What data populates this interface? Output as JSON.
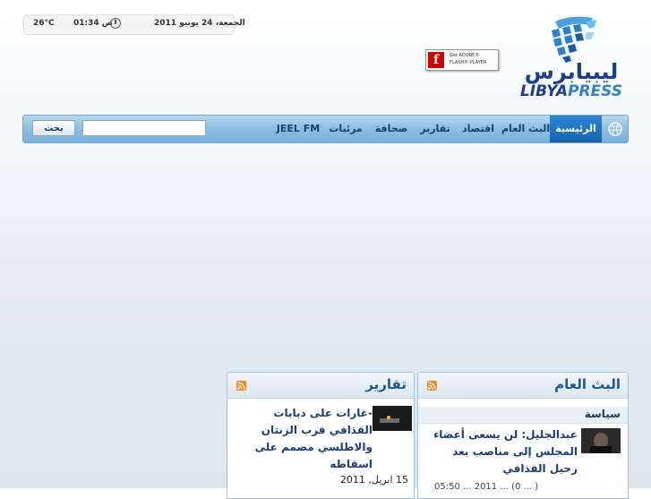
{
  "infobar": {
    "temperature": "26°C",
    "time": "01:34 ص",
    "date": "الجمعة، 24 يونيو 2011"
  },
  "flash_badge": {
    "logo_letter": "f",
    "line1": "Get ADOBE®",
    "line2": "FLASH® PLAYER"
  },
  "logo": {
    "arabic": "ليبيابرس",
    "latin_part1": "LIBYA",
    "latin_part2": "PRESS"
  },
  "nav": {
    "items": [
      {
        "label": "الرئيسية",
        "active": true
      },
      {
        "label": "البث العام"
      },
      {
        "label": "اقتصاد"
      },
      {
        "label": "تقارير"
      },
      {
        "label": "صحافة"
      },
      {
        "label": "مرئيات"
      },
      {
        "label": "JEEL FM"
      }
    ],
    "search_placeholder": "",
    "search_button": "بحث"
  },
  "panels": {
    "broadcast": {
      "title": "البث العام",
      "category": "سياسة",
      "headline": "عبدالجليل: لن يسعى أعضاء المجلس إلى مناصب بعد رحيل القذافي",
      "meta": "05:50 ... 2011 ... (0 ... )"
    },
    "reports": {
      "title": "تقارير",
      "headline": "-غارات على دبابات القذافي قرب الزنتان والاطلسي مصمم على اسقاطه",
      "date": "15 ابريل, 2011"
    }
  },
  "colors": {
    "nav_active": "#1565b0",
    "nav_bg": "#8fbfe3",
    "headline": "#1a3e7a",
    "rss": "#f08a24"
  }
}
